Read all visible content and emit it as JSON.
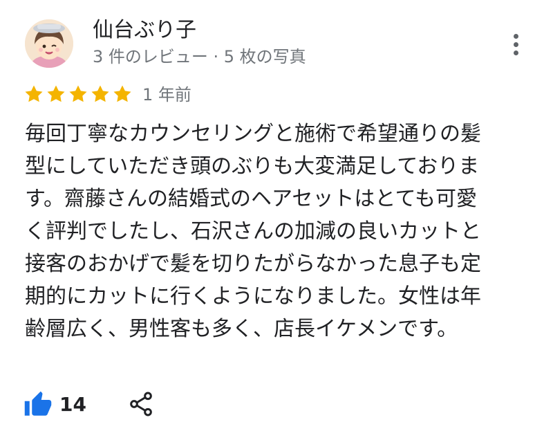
{
  "reviewer": {
    "name": "仙台ぶり子",
    "meta": "3 件のレビュー · 5 枚の写真"
  },
  "review": {
    "rating": 5,
    "rating_max": 5,
    "date": "1 年前",
    "text": "毎回丁寧なカウンセリングと施術で希望通りの髪型にしていただき頭のぶりも大変満足しております。齋藤さんの結婚式のヘアセットはとても可愛く評判でしたし、石沢さんの加減の良いカットと接客のおかげで髪を切りたがらなかった息子も定期的にカットに行くようになりました。女性は年齢層広く、男性客も多く、店長イケメンです。"
  },
  "actions": {
    "like_count": "14",
    "like_icon": "thumbs-up-icon",
    "share_icon": "share-icon",
    "more_icon": "more-vert-icon"
  },
  "colors": {
    "star": "#f4b400",
    "like": "#1a73e8",
    "secondary_text": "#70757a",
    "icon_gray": "#5f6368"
  }
}
